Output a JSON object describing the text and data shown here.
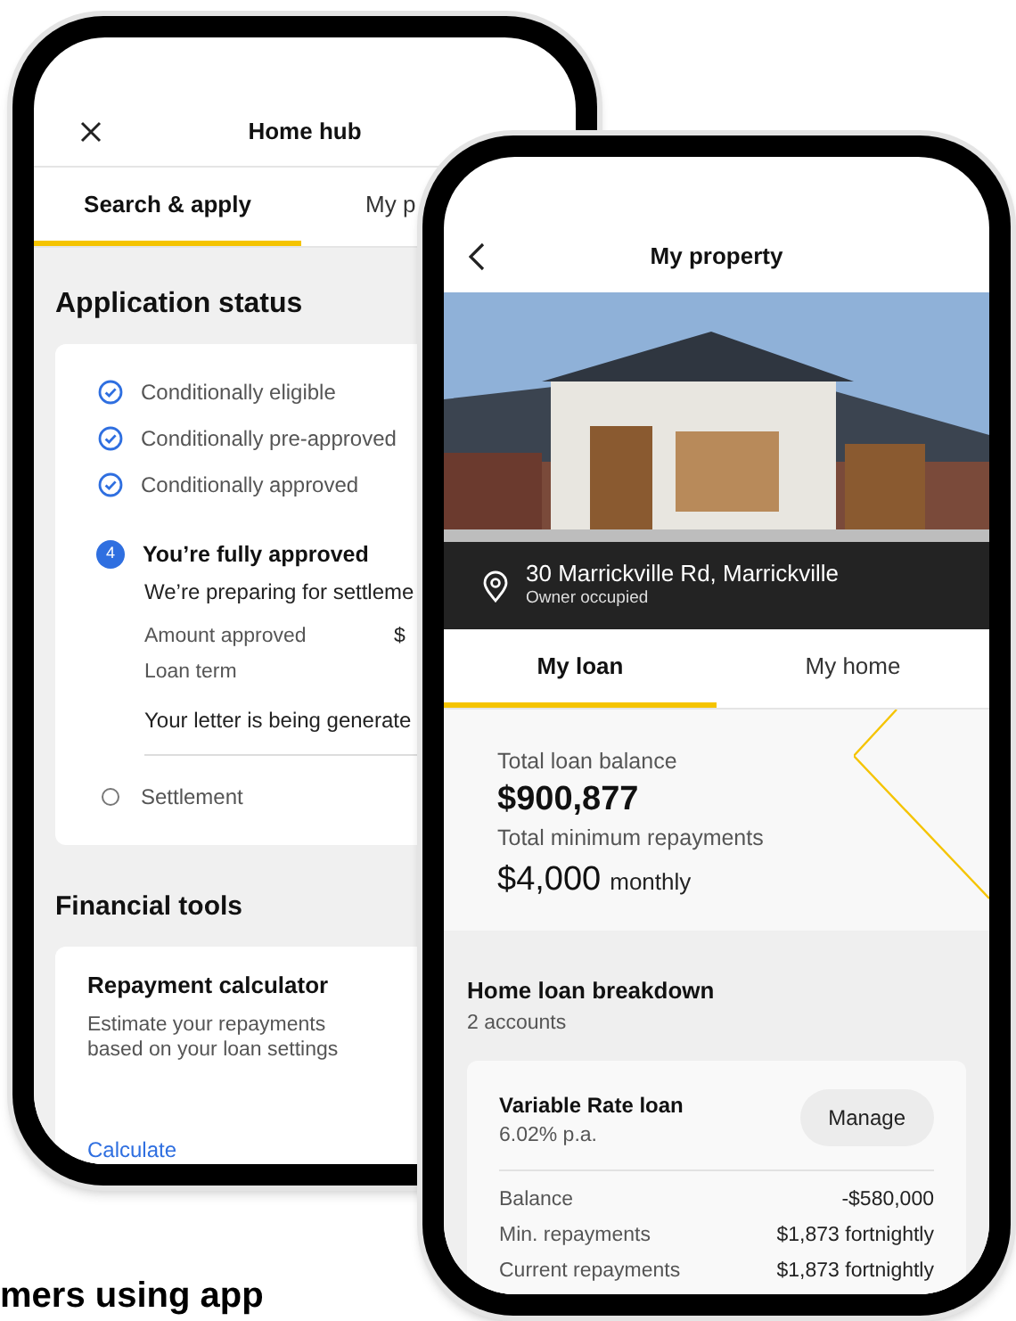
{
  "home_hub": {
    "title": "Home hub",
    "tabs": [
      {
        "label": "Search & apply",
        "selected": true
      },
      {
        "label": "My p",
        "selected": false
      }
    ],
    "application_status": {
      "title": "Application status",
      "steps": [
        {
          "kind": "done",
          "label": "Conditionally eligible"
        },
        {
          "kind": "done",
          "label": "Conditionally pre-approved"
        },
        {
          "kind": "done",
          "label": "Conditionally approved"
        },
        {
          "kind": "current",
          "number": "4",
          "label": "You’re fully approved",
          "subtitle": "We’re preparing for settleme",
          "rows": [
            {
              "label": "Amount approved",
              "value": "$"
            },
            {
              "label": "Loan term"
            }
          ],
          "note": "Your letter is being generate"
        },
        {
          "kind": "pending",
          "label": "Settlement"
        }
      ]
    },
    "financial_tools": {
      "title": "Financial tools",
      "card": {
        "title": "Repayment calculator",
        "description": "Estimate your repayments based on your loan settings",
        "link": "Calculate"
      }
    }
  },
  "my_property": {
    "title": "My property",
    "address": "30 Marrickville Rd, Marrickville",
    "occupancy": "Owner occupied",
    "tabs": [
      {
        "label": "My loan",
        "selected": true
      },
      {
        "label": "My home",
        "selected": false
      }
    ],
    "summary": {
      "balance_label": "Total loan balance",
      "balance": "$900,877",
      "repayments_label": "Total minimum repayments",
      "repayments": "$4,000",
      "repayments_period": "monthly"
    },
    "breakdown": {
      "title": "Home loan breakdown",
      "count": "2 accounts",
      "loan": {
        "name": "Variable Rate loan",
        "rate": "6.02% p.a.",
        "button": "Manage",
        "rows": [
          {
            "label": "Balance",
            "value": "-$580,000"
          },
          {
            "label": "Min. repayments",
            "value": "$1,873 fortnightly"
          },
          {
            "label": "Current repayments",
            "value": "$1,873 fortnightly"
          }
        ]
      }
    }
  },
  "page_heading": "mers using app"
}
